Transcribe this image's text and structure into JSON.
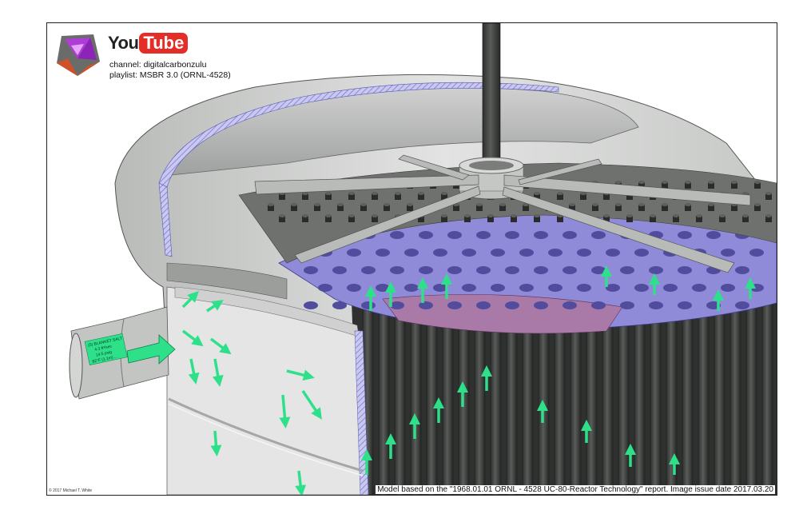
{
  "branding": {
    "logo_icon": "purple-tetrahedron-logo",
    "youtube_you": "You",
    "youtube_tube": "Tube",
    "channel": "channel: digitalcarbonzulu",
    "playlist": "playlist: MSBR 3.0 (ORNL-4528)"
  },
  "inlet_label": {
    "line1": "(5) BLANKET SALT",
    "line2": "4.3 ft³/sec",
    "line3": "14.5 psig",
    "line4": "82°F (1.1m) ..."
  },
  "footer": {
    "copyright": "© 2017 Michael T. White",
    "source": "Model based on the \"1968.01.01 ORNL - 4528 UC-80-Reactor Technology\" report.  Image issue date 2017.03.20"
  },
  "colors": {
    "vessel": "#d4d6d4",
    "graphite": "#3a3c3a",
    "plate_blue": "#8f8bd8",
    "plate_pink": "#a97aa8",
    "flow_arrow": "#2fe08a",
    "youtube_red": "#e52d27"
  }
}
